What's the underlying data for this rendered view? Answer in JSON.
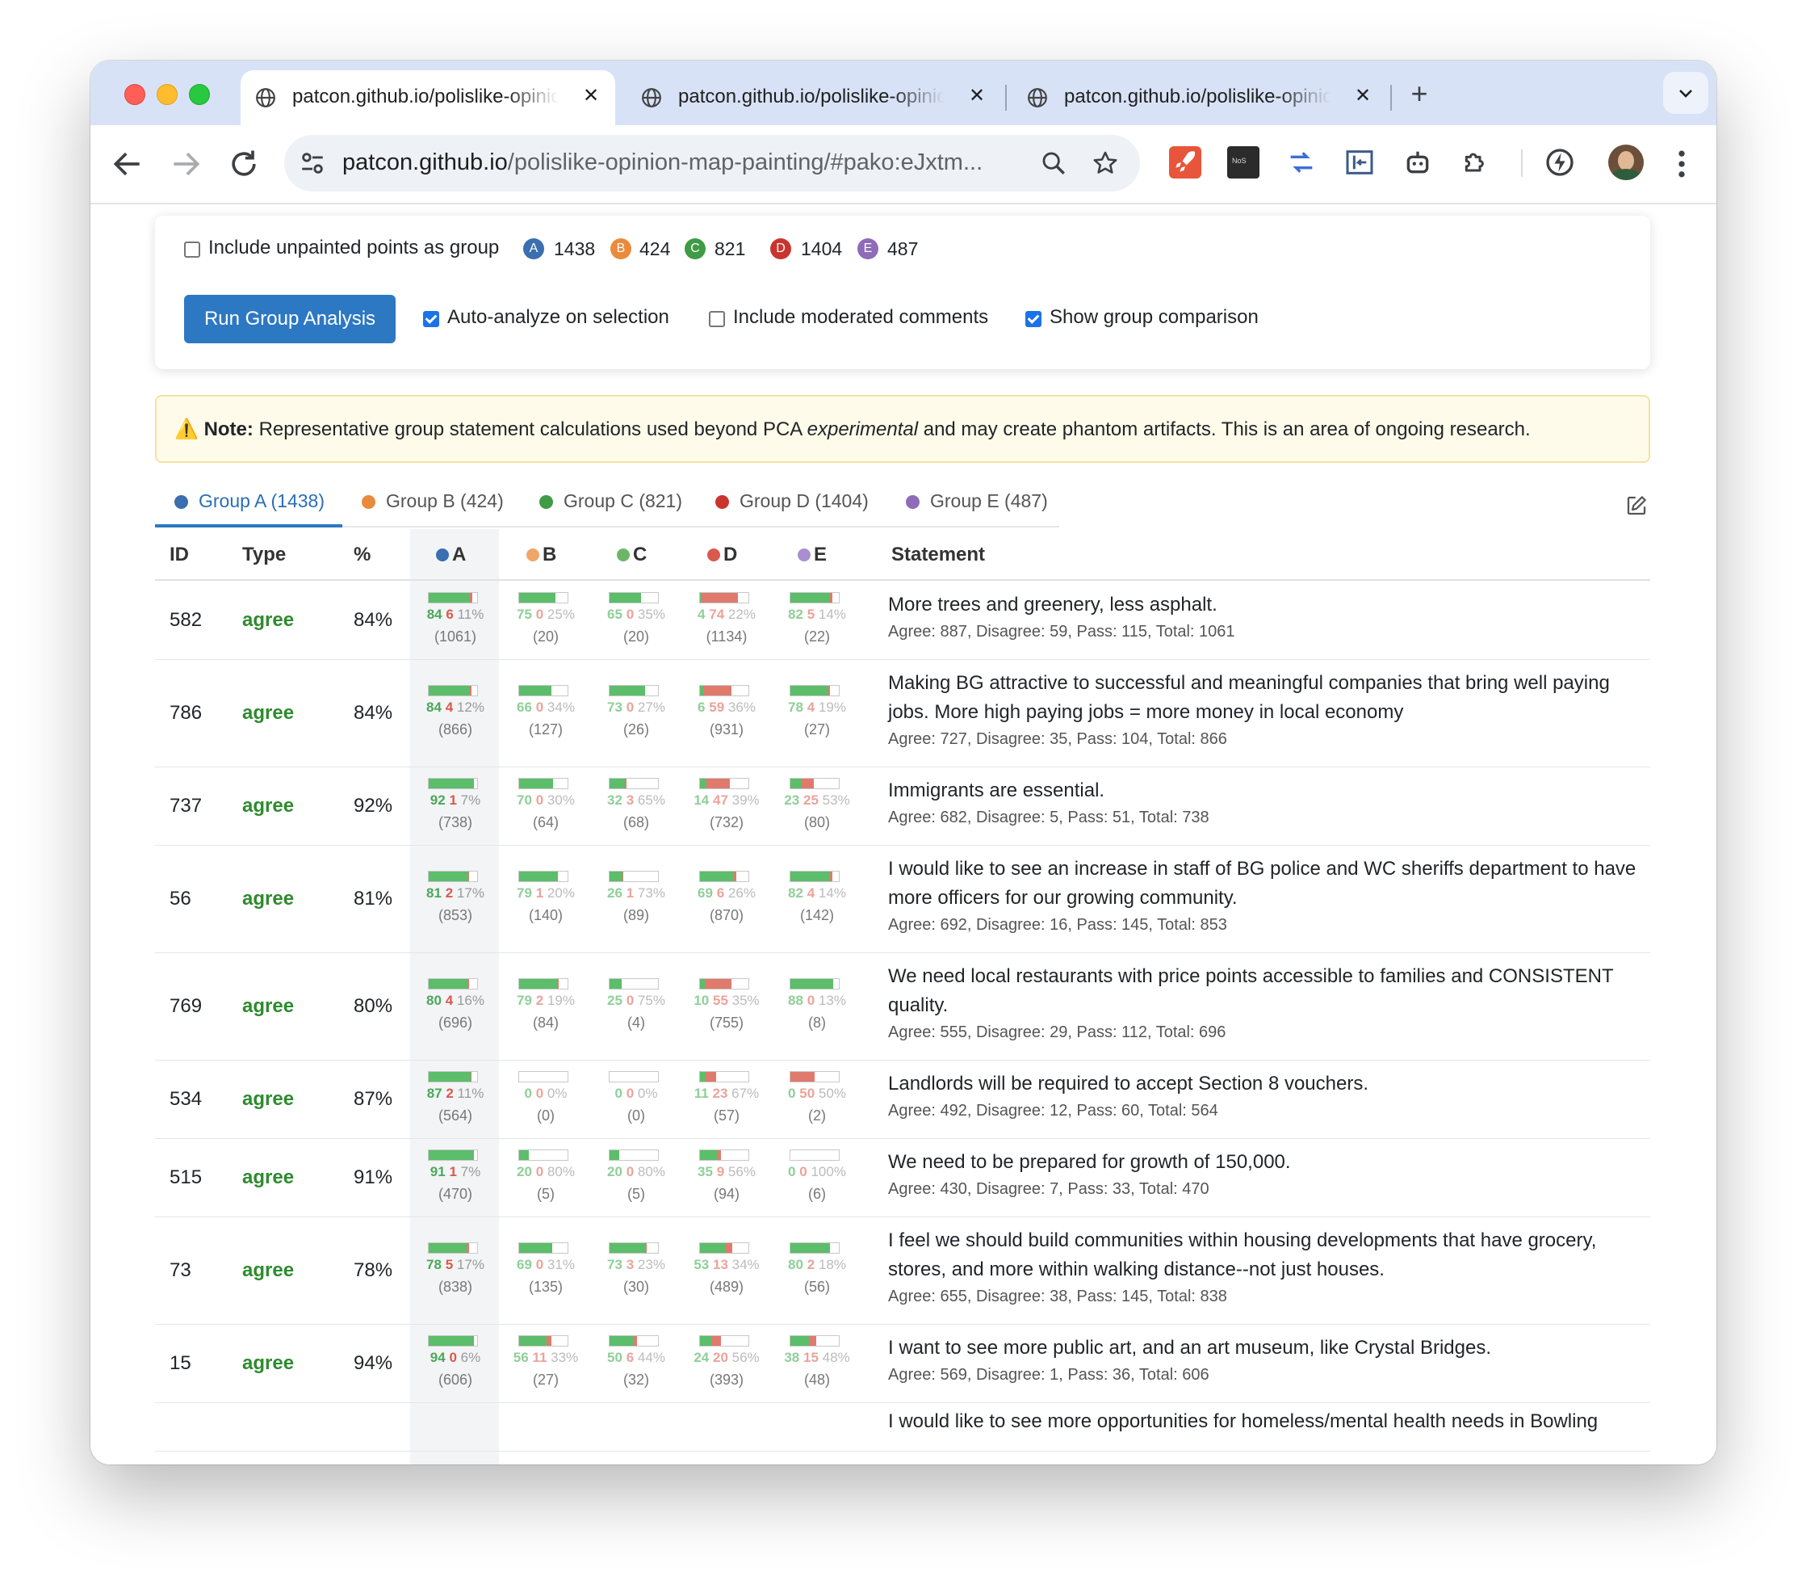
{
  "browser": {
    "tabs": [
      {
        "title": "patcon.github.io/polislike-opinion-map-painting",
        "active": true
      },
      {
        "title": "patcon.github.io/polislike-opinion-map-painting",
        "active": false
      },
      {
        "title": "patcon.github.io/polislike-opinion-map-painting",
        "active": false
      }
    ],
    "url_host": "patcon.github.io",
    "url_path": "/polislike-opinion-map-painting/#pako:eJxtm..."
  },
  "controls": {
    "include_unpainted_label": "Include unpainted points as group",
    "include_unpainted_checked": false,
    "groups": [
      {
        "letter": "A",
        "count": "1438",
        "color": "#3a6fb0"
      },
      {
        "letter": "B",
        "count": "424",
        "color": "#e98b3c"
      },
      {
        "letter": "C",
        "count": "821",
        "color": "#3f9b45"
      },
      {
        "letter": "D",
        "count": "1404",
        "color": "#c9352e"
      },
      {
        "letter": "E",
        "count": "487",
        "color": "#8e6cb8"
      }
    ],
    "run_button": "Run Group Analysis",
    "auto_analyze_label": "Auto-analyze on selection",
    "auto_analyze_checked": true,
    "include_moderated_label": "Include moderated comments",
    "include_moderated_checked": false,
    "show_comparison_label": "Show group comparison",
    "show_comparison_checked": true
  },
  "note": {
    "icon": "⚠️",
    "bold": "Note:",
    "text_before": "Representative group statement calculations used beyond PCA ",
    "italic": "experimental",
    "text_after": " and may create phantom artifacts. This is an area of ongoing research."
  },
  "group_tabs": [
    {
      "label": "Group A (1438)",
      "color": "#3a6fb0",
      "active": true
    },
    {
      "label": "Group B (424)",
      "color": "#e98b3c",
      "active": false
    },
    {
      "label": "Group C (821)",
      "color": "#3f9b45",
      "active": false
    },
    {
      "label": "Group D (1404)",
      "color": "#c9352e",
      "active": false
    },
    {
      "label": "Group E (487)",
      "color": "#8e6cb8",
      "active": false
    }
  ],
  "table": {
    "headers": {
      "id": "ID",
      "type": "Type",
      "pct": "%",
      "a": "A",
      "b": "B",
      "c": "C",
      "d": "D",
      "e": "E",
      "statement": "Statement"
    },
    "rows": [
      {
        "id": "582",
        "type": "agree",
        "pct": "84%",
        "groups": [
          {
            "a": "84",
            "d": "6",
            "p": "11%",
            "t": "(1061)"
          },
          {
            "a": "75",
            "d": "0",
            "p": "25%",
            "t": "(20)"
          },
          {
            "a": "65",
            "d": "0",
            "p": "35%",
            "t": "(20)"
          },
          {
            "a": "4",
            "d": "74",
            "p": "22%",
            "t": "(1134)"
          },
          {
            "a": "82",
            "d": "5",
            "p": "14%",
            "t": "(22)"
          }
        ],
        "statement": "More trees and greenery, less asphalt.",
        "sub": "Agree: 887, Disagree: 59, Pass: 115, Total: 1061"
      },
      {
        "id": "786",
        "type": "agree",
        "pct": "84%",
        "groups": [
          {
            "a": "84",
            "d": "4",
            "p": "12%",
            "t": "(866)"
          },
          {
            "a": "66",
            "d": "0",
            "p": "34%",
            "t": "(127)"
          },
          {
            "a": "73",
            "d": "0",
            "p": "27%",
            "t": "(26)"
          },
          {
            "a": "6",
            "d": "59",
            "p": "36%",
            "t": "(931)"
          },
          {
            "a": "78",
            "d": "4",
            "p": "19%",
            "t": "(27)"
          }
        ],
        "statement": "Making BG attractive to successful and meaningful companies that bring well paying jobs. More high paying jobs = more money in local economy",
        "sub": "Agree: 727, Disagree: 35, Pass: 104, Total: 866"
      },
      {
        "id": "737",
        "type": "agree",
        "pct": "92%",
        "groups": [
          {
            "a": "92",
            "d": "1",
            "p": "7%",
            "t": "(738)"
          },
          {
            "a": "70",
            "d": "0",
            "p": "30%",
            "t": "(64)"
          },
          {
            "a": "32",
            "d": "3",
            "p": "65%",
            "t": "(68)"
          },
          {
            "a": "14",
            "d": "47",
            "p": "39%",
            "t": "(732)"
          },
          {
            "a": "23",
            "d": "25",
            "p": "53%",
            "t": "(80)"
          }
        ],
        "statement": "Immigrants are essential.",
        "sub": "Agree: 682, Disagree: 5, Pass: 51, Total: 738"
      },
      {
        "id": "56",
        "type": "agree",
        "pct": "81%",
        "groups": [
          {
            "a": "81",
            "d": "2",
            "p": "17%",
            "t": "(853)"
          },
          {
            "a": "79",
            "d": "1",
            "p": "20%",
            "t": "(140)"
          },
          {
            "a": "26",
            "d": "1",
            "p": "73%",
            "t": "(89)"
          },
          {
            "a": "69",
            "d": "6",
            "p": "26%",
            "t": "(870)"
          },
          {
            "a": "82",
            "d": "4",
            "p": "14%",
            "t": "(142)"
          }
        ],
        "statement": "I would like to see an increase in staff of BG police and WC sheriffs department to have more officers for our growing community.",
        "sub": "Agree: 692, Disagree: 16, Pass: 145, Total: 853"
      },
      {
        "id": "769",
        "type": "agree",
        "pct": "80%",
        "groups": [
          {
            "a": "80",
            "d": "4",
            "p": "16%",
            "t": "(696)"
          },
          {
            "a": "79",
            "d": "2",
            "p": "19%",
            "t": "(84)"
          },
          {
            "a": "25",
            "d": "0",
            "p": "75%",
            "t": "(4)"
          },
          {
            "a": "10",
            "d": "55",
            "p": "35%",
            "t": "(755)"
          },
          {
            "a": "88",
            "d": "0",
            "p": "13%",
            "t": "(8)"
          }
        ],
        "statement": "We need local restaurants with price points accessible to families and CONSISTENT quality.",
        "sub": "Agree: 555, Disagree: 29, Pass: 112, Total: 696"
      },
      {
        "id": "534",
        "type": "agree",
        "pct": "87%",
        "groups": [
          {
            "a": "87",
            "d": "2",
            "p": "11%",
            "t": "(564)"
          },
          {
            "a": "0",
            "d": "0",
            "p": "0%",
            "t": "(0)"
          },
          {
            "a": "0",
            "d": "0",
            "p": "0%",
            "t": "(0)"
          },
          {
            "a": "11",
            "d": "23",
            "p": "67%",
            "t": "(57)"
          },
          {
            "a": "0",
            "d": "50",
            "p": "50%",
            "t": "(2)"
          }
        ],
        "statement": "Landlords will be required to accept Section 8 vouchers.",
        "sub": "Agree: 492, Disagree: 12, Pass: 60, Total: 564"
      },
      {
        "id": "515",
        "type": "agree",
        "pct": "91%",
        "groups": [
          {
            "a": "91",
            "d": "1",
            "p": "7%",
            "t": "(470)"
          },
          {
            "a": "20",
            "d": "0",
            "p": "80%",
            "t": "(5)"
          },
          {
            "a": "20",
            "d": "0",
            "p": "80%",
            "t": "(5)"
          },
          {
            "a": "35",
            "d": "9",
            "p": "56%",
            "t": "(94)"
          },
          {
            "a": "0",
            "d": "0",
            "p": "100%",
            "t": "(6)"
          }
        ],
        "statement": "We need to be prepared for growth of 150,000.",
        "sub": "Agree: 430, Disagree: 7, Pass: 33, Total: 470"
      },
      {
        "id": "73",
        "type": "agree",
        "pct": "78%",
        "groups": [
          {
            "a": "78",
            "d": "5",
            "p": "17%",
            "t": "(838)"
          },
          {
            "a": "69",
            "d": "0",
            "p": "31%",
            "t": "(135)"
          },
          {
            "a": "73",
            "d": "3",
            "p": "23%",
            "t": "(30)"
          },
          {
            "a": "53",
            "d": "13",
            "p": "34%",
            "t": "(489)"
          },
          {
            "a": "80",
            "d": "2",
            "p": "18%",
            "t": "(56)"
          }
        ],
        "statement": "I feel we should build communities within housing developments that have grocery, stores, and more within walking distance--not just houses.",
        "sub": "Agree: 655, Disagree: 38, Pass: 145, Total: 838"
      },
      {
        "id": "15",
        "type": "agree",
        "pct": "94%",
        "groups": [
          {
            "a": "94",
            "d": "0",
            "p": "6%",
            "t": "(606)"
          },
          {
            "a": "56",
            "d": "11",
            "p": "33%",
            "t": "(27)"
          },
          {
            "a": "50",
            "d": "6",
            "p": "44%",
            "t": "(32)"
          },
          {
            "a": "24",
            "d": "20",
            "p": "56%",
            "t": "(393)"
          },
          {
            "a": "38",
            "d": "15",
            "p": "48%",
            "t": "(48)"
          }
        ],
        "statement": "I want to see more public art, and an art museum, like Crystal Bridges.",
        "sub": "Agree: 569, Disagree: 1, Pass: 36, Total: 606"
      },
      {
        "id": "",
        "type": "",
        "pct": "",
        "groups": [],
        "statement": "I would like to see more opportunities for homeless/mental health needs in Bowling",
        "sub": ""
      }
    ]
  }
}
